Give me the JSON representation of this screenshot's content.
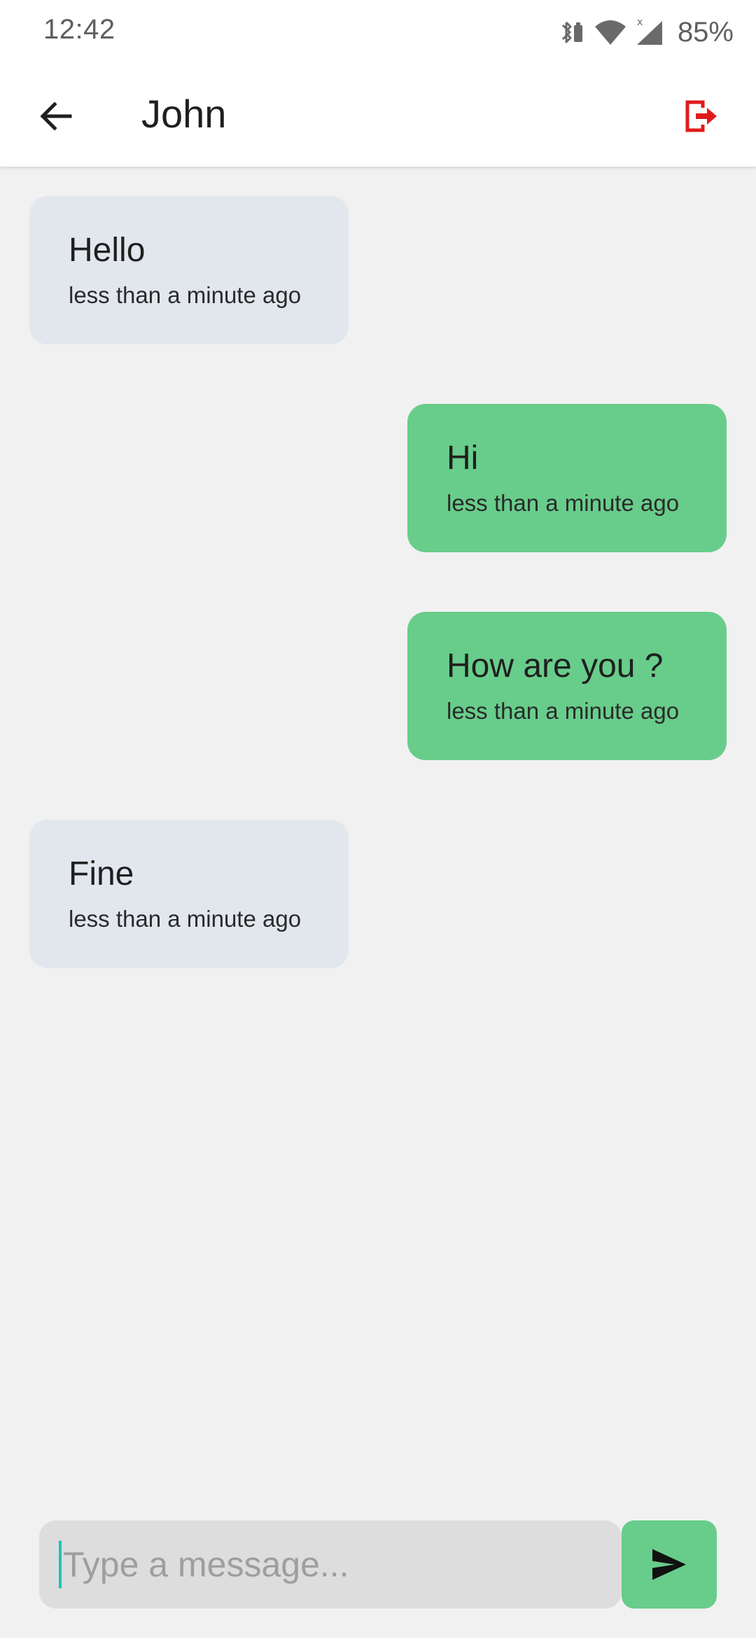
{
  "status_bar": {
    "time": "12:42",
    "battery": "85%",
    "icons": [
      "bluetooth-battery-icon",
      "wifi-icon",
      "signal-icon"
    ]
  },
  "app_bar": {
    "title": "John",
    "back_icon": "arrow-back-icon",
    "logout_icon": "logout-icon",
    "logout_color": "#e01b1b"
  },
  "messages": [
    {
      "direction": "received",
      "text": "Hello",
      "time": "less than a minute ago"
    },
    {
      "direction": "sent",
      "text": "Hi",
      "time": "less than a minute ago"
    },
    {
      "direction": "sent",
      "text": "How are you ?",
      "time": "less than a minute ago"
    },
    {
      "direction": "received",
      "text": "Fine",
      "time": "less than a minute ago"
    }
  ],
  "composer": {
    "placeholder": "Type a message...",
    "value": "",
    "send_icon": "send-icon"
  },
  "colors": {
    "sent_bubble": "#68cd8a",
    "received_bubble": "#e1e7ed",
    "background": "#f1f1f1"
  }
}
